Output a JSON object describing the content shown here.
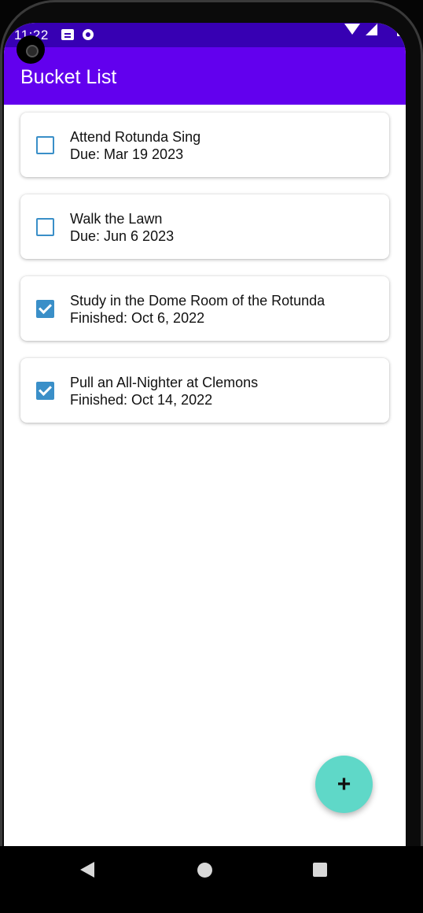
{
  "status_bar": {
    "time": "11:22",
    "icons": [
      "notification-icon",
      "assistant-icon",
      "wifi-icon",
      "signal-icon",
      "battery-icon"
    ]
  },
  "app_bar": {
    "title": "Bucket List"
  },
  "items": [
    {
      "title": "Attend Rotunda Sing",
      "subtitle": "Due: Mar 19 2023",
      "checked": false
    },
    {
      "title": "Walk the Lawn",
      "subtitle": "Due: Jun 6 2023",
      "checked": false
    },
    {
      "title": "Study in the Dome Room of the Rotunda",
      "subtitle": "Finished: Oct 6, 2022",
      "checked": true
    },
    {
      "title": "Pull an All-Nighter at Clemons",
      "subtitle": "Finished: Oct 14, 2022",
      "checked": true
    }
  ],
  "fab": {
    "label": "+"
  },
  "nav": {
    "icons": [
      "back-icon",
      "home-icon",
      "recents-icon"
    ]
  },
  "colors": {
    "status_bar": "#3700b3",
    "app_bar": "#6200ee",
    "checkbox": "#3a8fc8",
    "fab": "#5fd8c8"
  }
}
